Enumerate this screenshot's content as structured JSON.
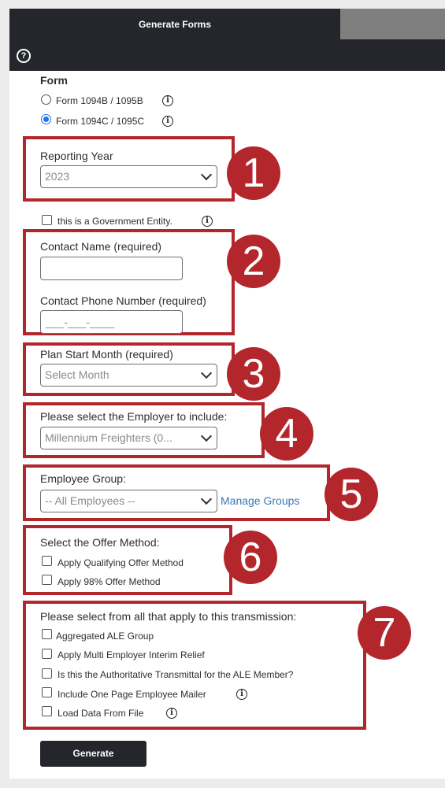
{
  "header": {
    "title": "Generate Forms"
  },
  "form_section": {
    "label": "Form",
    "options": [
      {
        "label": "Form 1094B / 1095B",
        "selected": false
      },
      {
        "label": "Form 1094C / 1095C",
        "selected": true
      }
    ]
  },
  "reporting_year": {
    "label": "Reporting Year",
    "value": "2023",
    "step": "1"
  },
  "government_entity": {
    "label": "this is a Government Entity.",
    "checked": false
  },
  "contact": {
    "step": "2",
    "name_label": "Contact Name (required)",
    "name_value": "",
    "phone_label": "Contact Phone Number (required)",
    "phone_placeholder": "___-___-____"
  },
  "plan_start": {
    "step": "3",
    "label": "Plan Start Month (required)",
    "placeholder": "Select Month"
  },
  "employer": {
    "step": "4",
    "label": "Please select the Employer to include:",
    "value": "Millennium Freighters (0..."
  },
  "employee_group": {
    "step": "5",
    "label": "Employee Group:",
    "value": "-- All Employees --",
    "manage_link": "Manage Groups"
  },
  "offer_method": {
    "step": "6",
    "label": "Select the Offer Method:",
    "options": [
      {
        "label": "Apply Qualifying Offer Method",
        "checked": false
      },
      {
        "label": "Apply 98% Offer Method",
        "checked": false
      }
    ]
  },
  "transmission": {
    "step": "7",
    "label": "Please select from all that apply to this transmission:",
    "options": [
      {
        "label": "Aggregated ALE Group",
        "checked": false
      },
      {
        "label": "Apply Multi Employer Interim Relief",
        "checked": false
      },
      {
        "label": "Is this the Authoritative Transmittal for the ALE Member?",
        "checked": false
      },
      {
        "label": "Include One Page Employee Mailer",
        "checked": false
      },
      {
        "label": "Load Data From File",
        "checked": false
      }
    ]
  },
  "generate_button": "Generate",
  "colors": {
    "highlight": "#b3262c",
    "header": "#24262b",
    "link": "#3a78b5",
    "radio_selected": "#1a73e8"
  }
}
